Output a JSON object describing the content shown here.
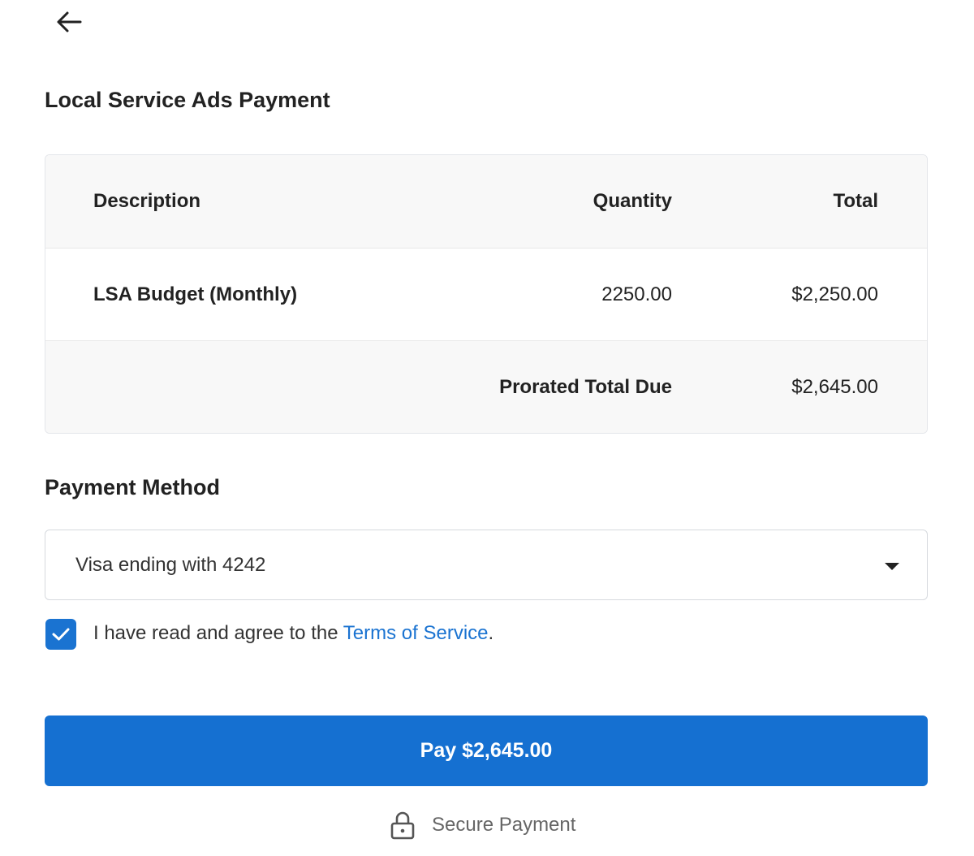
{
  "header": {
    "back_icon": "arrow-left-icon",
    "title": "Local Service Ads Payment"
  },
  "table": {
    "columns": [
      "Description",
      "Quantity",
      "Total"
    ],
    "rows": [
      {
        "description": "LSA Budget (Monthly)",
        "quantity": "2250.00",
        "total": "$2,250.00"
      }
    ],
    "summary": {
      "label": "Prorated Total Due",
      "total": "$2,645.00"
    }
  },
  "payment": {
    "section_title": "Payment Method",
    "selected_method": "Visa ending with 4242",
    "dropdown_icon": "caret-down-icon"
  },
  "agreement": {
    "checked": true,
    "text_before": "I have read and agree to the ",
    "link_text": "Terms of Service",
    "text_after": "."
  },
  "pay_button": {
    "label": "Pay $2,645.00"
  },
  "footer": {
    "secure_icon": "lock-icon",
    "secure_label": "Secure Payment"
  },
  "colors": {
    "accent": "#1570d1",
    "link": "#1a73d1",
    "table_header_bg": "#f8f8f8",
    "border": "#e4e6ea"
  }
}
